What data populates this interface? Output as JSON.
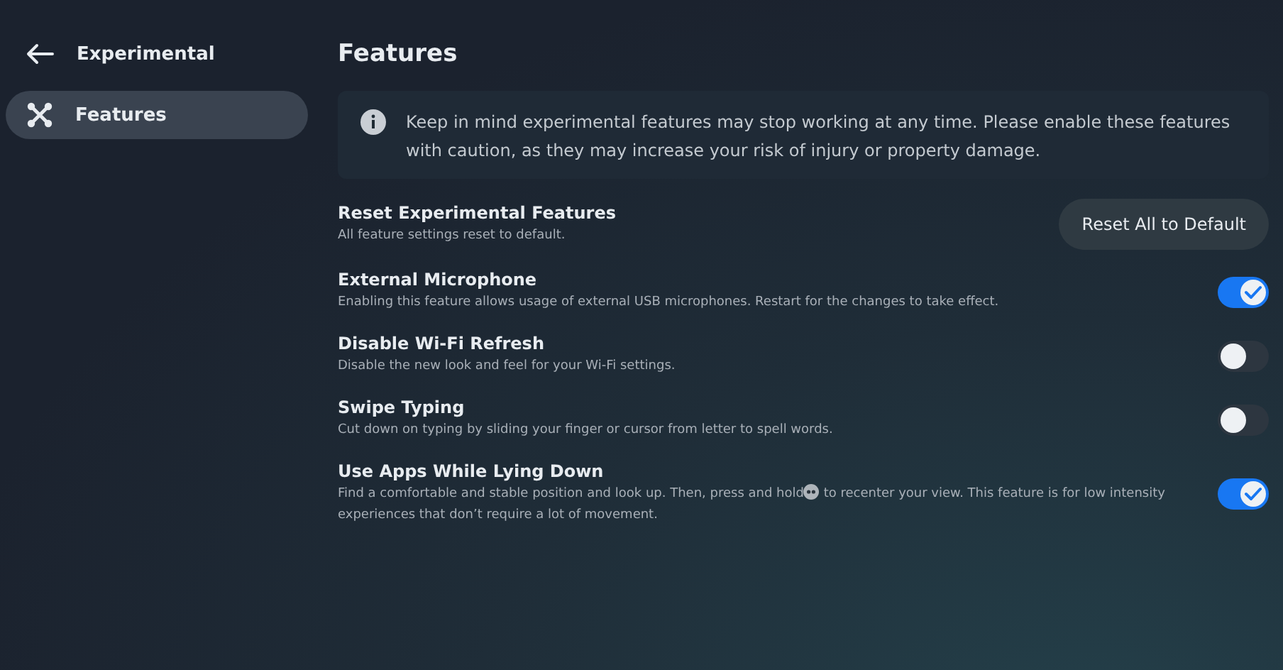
{
  "sidebar": {
    "back": {
      "label": "Experimental"
    },
    "items": [
      {
        "label": "Features",
        "selected": true
      }
    ]
  },
  "page_title": "Features",
  "notice": "Keep in mind experimental features may stop working at any time. Please enable these features with caution, as they may increase your risk of injury or property damage.",
  "settings": [
    {
      "kind": "button",
      "title": "Reset Experimental Features",
      "description": "All feature settings reset to default.",
      "button": "Reset All to Default"
    },
    {
      "kind": "toggle",
      "title": "External Microphone",
      "description": "Enabling this feature allows usage of external USB microphones. Restart for the changes to take effect.",
      "on": true
    },
    {
      "kind": "toggle",
      "title": "Disable Wi-Fi Refresh",
      "description": "Disable the new look and feel for your Wi-Fi settings.",
      "on": false
    },
    {
      "kind": "toggle",
      "title": "Swipe Typing",
      "description": "Cut down on typing by sliding your finger or cursor from letter to spell words.",
      "on": false
    },
    {
      "kind": "toggle",
      "title": "Use Apps While Lying Down",
      "description": "Find a comfortable and stable position and look up. Then, press and hold",
      "description_after": "to recenter your view. This feature is for low intensity experiences that don’t require a lot of movement.",
      "on": true
    }
  ]
}
